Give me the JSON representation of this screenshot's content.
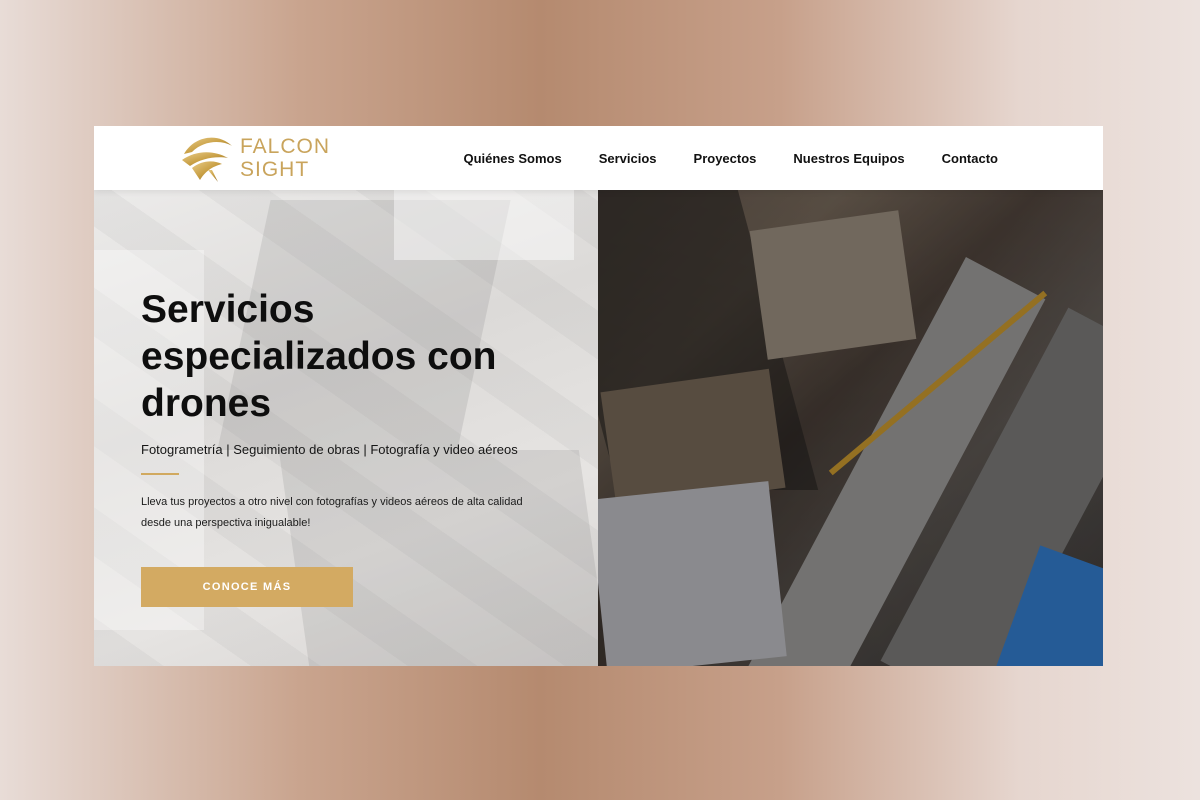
{
  "brand": {
    "line1": "FALCON",
    "line2": "SIGHT",
    "icon": "falcon-logo-icon",
    "color": "#c9a45c"
  },
  "nav": {
    "items": [
      {
        "label": "Quiénes Somos"
      },
      {
        "label": "Servicios"
      },
      {
        "label": "Proyectos"
      },
      {
        "label": "Nuestros Equipos"
      },
      {
        "label": "Contacto"
      }
    ]
  },
  "hero": {
    "title": "Servicios especializados con drones",
    "subtitle": "Fotogrametría | Seguimiento de obras | Fotografía y video aéreos",
    "description": "Lleva tus proyectos a otro nivel con fotografías y videos aéreos de alta cali­dad desde una perspectiva inigualable!",
    "cta_label": "CONOCE MÁS",
    "accent_color": "#d3aa62"
  }
}
